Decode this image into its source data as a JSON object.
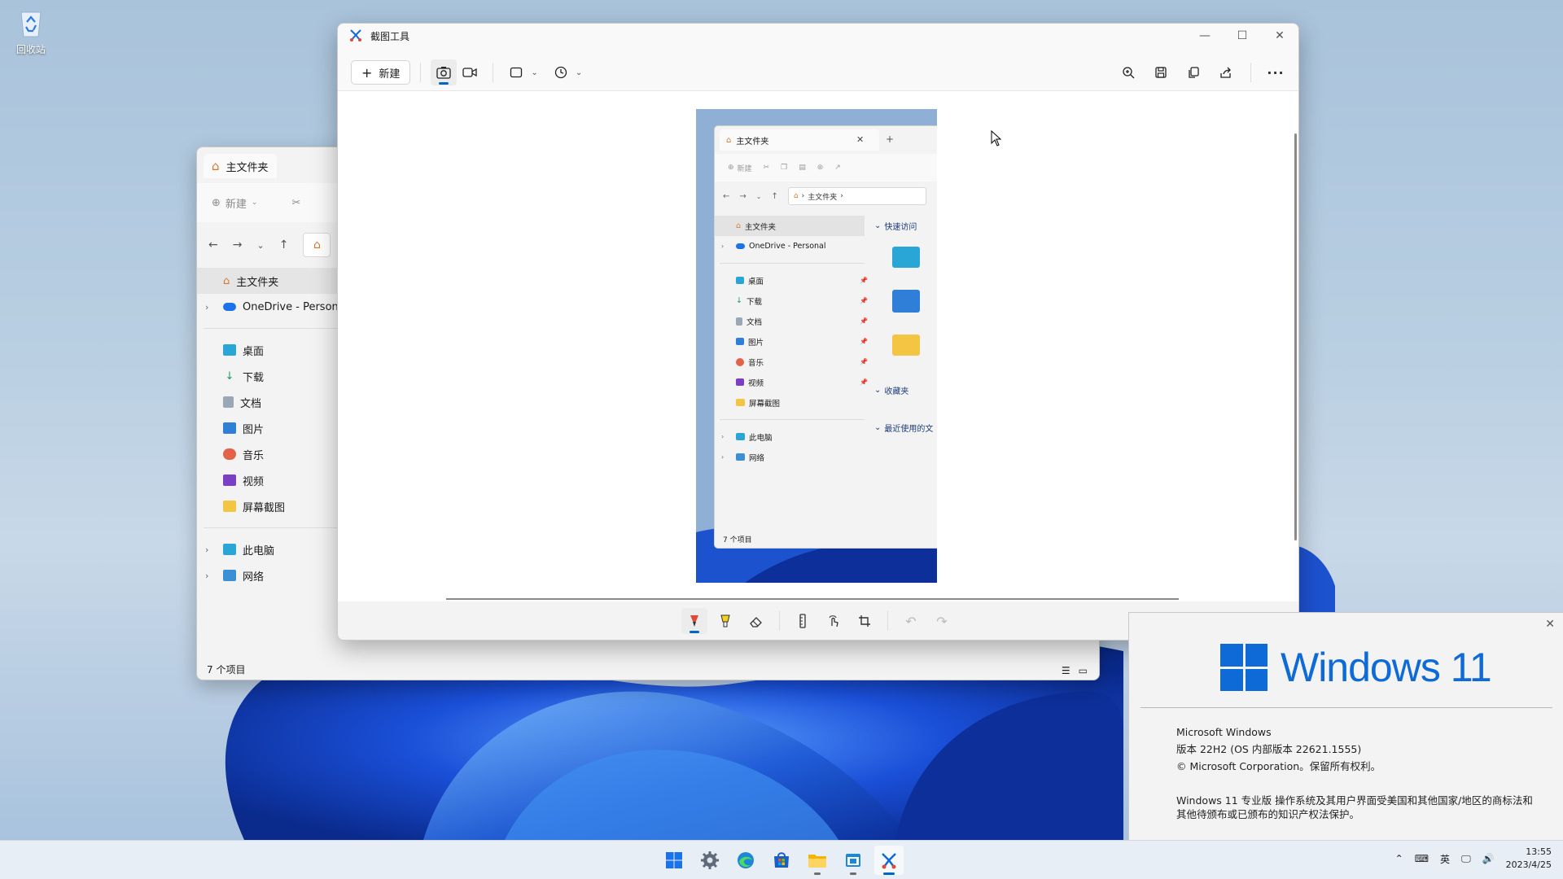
{
  "desktop": {
    "recycle_bin_label": "回收站"
  },
  "explorer": {
    "tab_title": "主文件夹",
    "new_label": "新建",
    "sidebar": {
      "home": "主文件夹",
      "onedrive": "OneDrive - Personal",
      "items": [
        "桌面",
        "下载",
        "文档",
        "图片",
        "音乐",
        "视频",
        "屏幕截图"
      ],
      "this_pc": "此电脑",
      "network": "网络"
    },
    "status": "7 个项目"
  },
  "snip": {
    "title": "截图工具",
    "new_label": "新建",
    "mini": {
      "tab_title": "主文件夹",
      "new_label": "新建",
      "address": "主文件夹",
      "home": "主文件夹",
      "onedrive": "OneDrive - Personal",
      "items": [
        "桌面",
        "下载",
        "文档",
        "图片",
        "音乐",
        "视频",
        "屏幕截图"
      ],
      "this_pc": "此电脑",
      "network": "网络",
      "quick_access": "快速访问",
      "favorites": "收藏夹",
      "recent": "最近使用的文",
      "status": "7 个项目"
    }
  },
  "winver": {
    "logo_text": "Windows 11",
    "line1": "Microsoft Windows",
    "line2": "版本 22H2 (OS 内部版本 22621.1555)",
    "line3": "© Microsoft Corporation。保留所有权利。",
    "legal": "Windows 11 专业版 操作系统及其用户界面受美国和其他国家/地区的商标法和其他待颁布或已颁布的知识产权法保护。"
  },
  "taskbar": {
    "ime": "英",
    "time": "13:55",
    "date": "2023/4/25"
  },
  "colors": {
    "accent": "#0067c0",
    "windows_blue": "#0e6ad7"
  }
}
